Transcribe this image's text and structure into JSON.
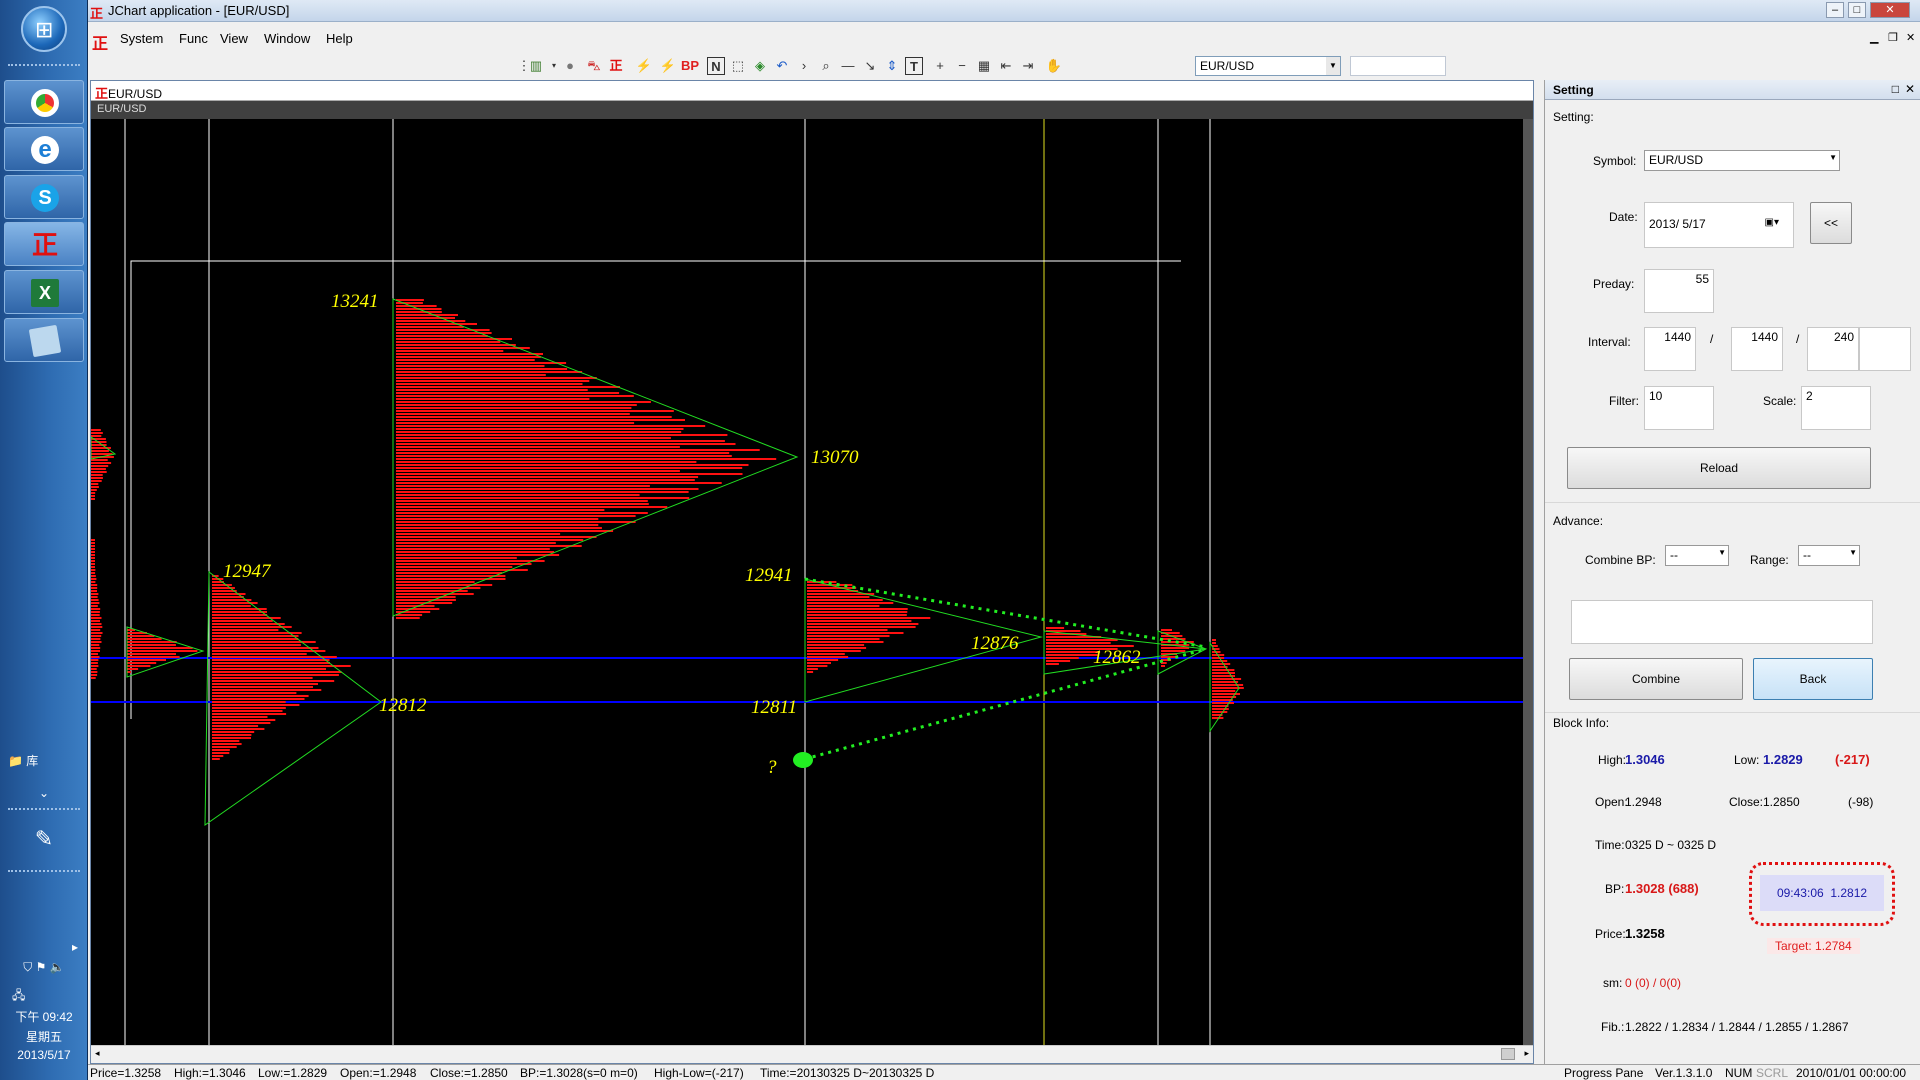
{
  "window": {
    "title": "JChart application - [EUR/USD]",
    "menu": [
      "System",
      "Func",
      "View",
      "Window",
      "Help"
    ],
    "symbol_combo": "EUR/USD"
  },
  "toolbar": {
    "icons": [
      "chart-type-icon",
      "circle-icon",
      "car-icon",
      "logo-icon",
      "lightning-icon",
      "lightning2-icon",
      "bp-text",
      "n-icon",
      "select-icon",
      "cube-icon",
      "undo-icon",
      "next-icon",
      "zoom-icon",
      "hline-icon",
      "trendline-icon",
      "arrows-icon",
      "text-icon",
      "plus-icon",
      "minus-icon",
      "grid-icon",
      "back-icon",
      "forward-icon",
      "hand-icon"
    ],
    "bp_label": "BP",
    "n_label": "N",
    "t_label": "T"
  },
  "chart": {
    "tab_title": "EUR/USD",
    "subtitle": "EUR/USD",
    "labels": [
      {
        "text": "13241"
      },
      {
        "text": "13070"
      },
      {
        "text": "12947"
      },
      {
        "text": "12812"
      },
      {
        "text": "12941"
      },
      {
        "text": "12876"
      },
      {
        "text": "12862"
      },
      {
        "text": "12811"
      },
      {
        "text": "?"
      }
    ],
    "colors": {
      "profile": "#ff1111",
      "triangle": "#22dd22",
      "level": "#0000ff",
      "label": "#ffff00",
      "grid": "#ffffff",
      "dot": "#22ee22"
    }
  },
  "setting": {
    "title": "Setting",
    "section_setting": "Setting:",
    "symbol_label": "Symbol:",
    "symbol_value": "EUR/USD",
    "date_label": "Date:",
    "date_value": "2013/  5/17",
    "date_back": "<<",
    "preday_label": "Preday:",
    "preday_value": "55",
    "interval_label": "Interval:",
    "interval_values": [
      "1440",
      "1440",
      "240",
      ""
    ],
    "interval_sep": "/",
    "filter_label": "Filter:",
    "filter_value": "10",
    "scale_label": "Scale:",
    "scale_value": "2",
    "reload": "Reload",
    "advance_label": "Advance:",
    "combine_bp_label": "Combine BP:",
    "combine_bp_value": "--",
    "range_label": "Range:",
    "range_value": "--",
    "combine_btn": "Combine",
    "back_btn": "Back",
    "block_info_label": "Block Info:",
    "high_label": "High:",
    "high_value": "1.3046",
    "low_label": "Low:",
    "low_value": "1.2829",
    "range_diff": "(-217)",
    "open_label": "Open:",
    "open_value": "1.2948",
    "close_label": "Close:",
    "close_value": "1.2850",
    "close_diff": "(-98)",
    "time_label": "Time:",
    "time_value": "0325 D ~ 0325 D",
    "bp_label": "BP:",
    "bp_value": "1.3028 (688)",
    "alert_time": "09:43:06",
    "alert_value": "1.2812",
    "price_label": "Price:",
    "price_value": "1.3258",
    "target": "Target: 1.2784",
    "sm_label": "sm:",
    "sm_value": "0 (0) / 0(0)",
    "fib_label": "Fib.:",
    "fib_value": "1.2822 / 1.2834 / 1.2844 / 1.2855 / 1.2867"
  },
  "status": {
    "price": "Price=1.3258",
    "high": "High:=1.3046",
    "low": "Low:=1.2829",
    "open": "Open:=1.2948",
    "close": "Close:=1.2850",
    "bp": "BP:=1.3028(s=0 m=0)",
    "highlow": "High-Low=(-217)",
    "time": "Time:=20130325 D~20130325 D",
    "progress": "Progress Pane",
    "version": "Ver.1.3.1.0",
    "num": "NUM",
    "scrl": "SCRL",
    "datetime": "2010/01/01 00:00:00"
  },
  "taskbar": {
    "clock": "下午 09:42",
    "weekday": "星期五",
    "date": "2013/5/17",
    "lib": "库"
  }
}
